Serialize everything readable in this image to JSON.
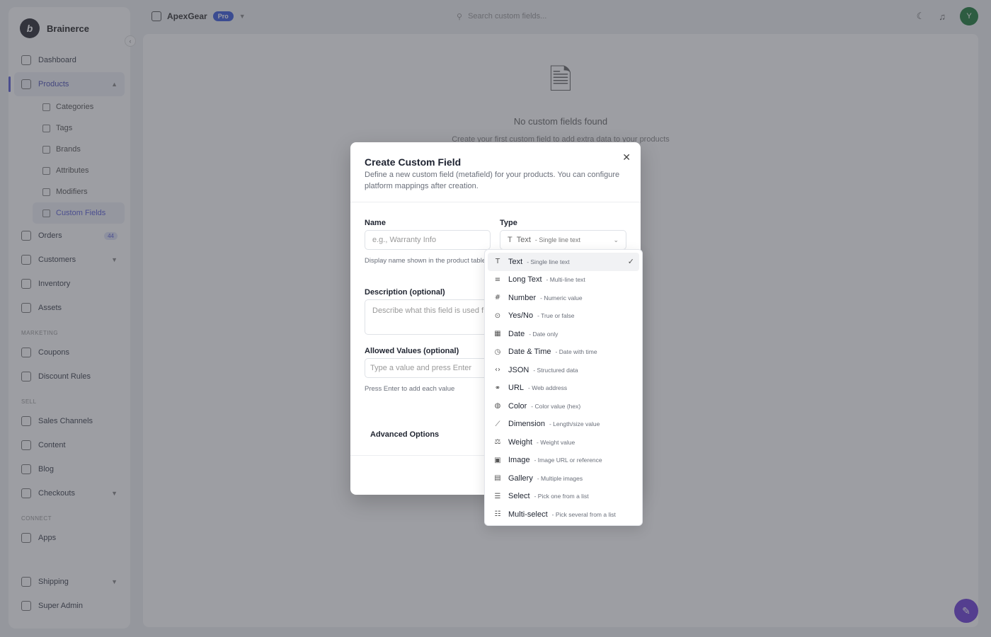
{
  "brand": {
    "name": "Brainerce",
    "logo": "b"
  },
  "store": {
    "name": "ApexGear",
    "badge": "Pro"
  },
  "search": {
    "placeholder": "Search custom fields..."
  },
  "user": {
    "initial": "Y"
  },
  "sidebar": {
    "items": [
      {
        "label": "Dashboard"
      },
      {
        "label": "Products"
      },
      {
        "label": "Categories"
      },
      {
        "label": "Tags"
      },
      {
        "label": "Brands"
      },
      {
        "label": "Attributes"
      },
      {
        "label": "Modifiers"
      },
      {
        "label": "Custom Fields"
      },
      {
        "label": "Orders",
        "badge": "44"
      },
      {
        "label": "Customers"
      },
      {
        "label": "Inventory"
      },
      {
        "label": "Assets"
      },
      {
        "label": "Coupons"
      },
      {
        "label": "Discount Rules"
      },
      {
        "label": "Sales Channels"
      },
      {
        "label": "Content"
      },
      {
        "label": "Blog"
      },
      {
        "label": "Checkouts"
      },
      {
        "label": "Apps"
      },
      {
        "label": "Shipping"
      },
      {
        "label": "Super Admin"
      }
    ],
    "sections": {
      "marketing": "MARKETING",
      "sell": "SELL",
      "connect": "CONNECT"
    }
  },
  "empty_state": {
    "title": "No custom fields found",
    "subtitle": "Create your first custom field to add extra data to your products"
  },
  "modal": {
    "title": "Create Custom Field",
    "description": "Define a new custom field (metafield) for your products. You can configure platform mappings after creation.",
    "name_label": "Name",
    "name_placeholder": "e.g., Warranty Info",
    "name_hint": "Display name shown in the product table",
    "type_label": "Type",
    "type_value": "Text",
    "type_value_desc": "- Single line text",
    "description_label": "Description (optional)",
    "description_placeholder": "Describe what this field is used f",
    "allowed_label": "Allowed Values (optional)",
    "allowed_placeholder": "Type a value and press Enter",
    "allowed_hint": "Press Enter to add each value",
    "advanced_label": "Advanced Options",
    "close_icon": "close-icon"
  },
  "type_options": [
    {
      "icon": "T",
      "label": "Text",
      "desc": "- Single line text",
      "selected": true
    },
    {
      "icon": "≡",
      "label": "Long Text",
      "desc": "- Multi-line text"
    },
    {
      "icon": "#",
      "label": "Number",
      "desc": "- Numeric value"
    },
    {
      "icon": "⊙",
      "label": "Yes/No",
      "desc": "- True or false"
    },
    {
      "icon": "▦",
      "label": "Date",
      "desc": "- Date only"
    },
    {
      "icon": "◷",
      "label": "Date & Time",
      "desc": "- Date with time"
    },
    {
      "icon": "‹›",
      "label": "JSON",
      "desc": "- Structured data"
    },
    {
      "icon": "⚭",
      "label": "URL",
      "desc": "- Web address"
    },
    {
      "icon": "◍",
      "label": "Color",
      "desc": "- Color value (hex)"
    },
    {
      "icon": "⟋",
      "label": "Dimension",
      "desc": "- Length/size value"
    },
    {
      "icon": "⚖",
      "label": "Weight",
      "desc": "- Weight value"
    },
    {
      "icon": "▣",
      "label": "Image",
      "desc": "- Image URL or reference"
    },
    {
      "icon": "▤",
      "label": "Gallery",
      "desc": "- Multiple images"
    },
    {
      "icon": "☰",
      "label": "Select",
      "desc": "- Pick one from a list"
    },
    {
      "icon": "☷",
      "label": "Multi-select",
      "desc": "- Pick several from a list"
    }
  ],
  "colors": {
    "accent": "#5b5fd6",
    "overlay": "rgba(60,62,72,0.5)"
  }
}
